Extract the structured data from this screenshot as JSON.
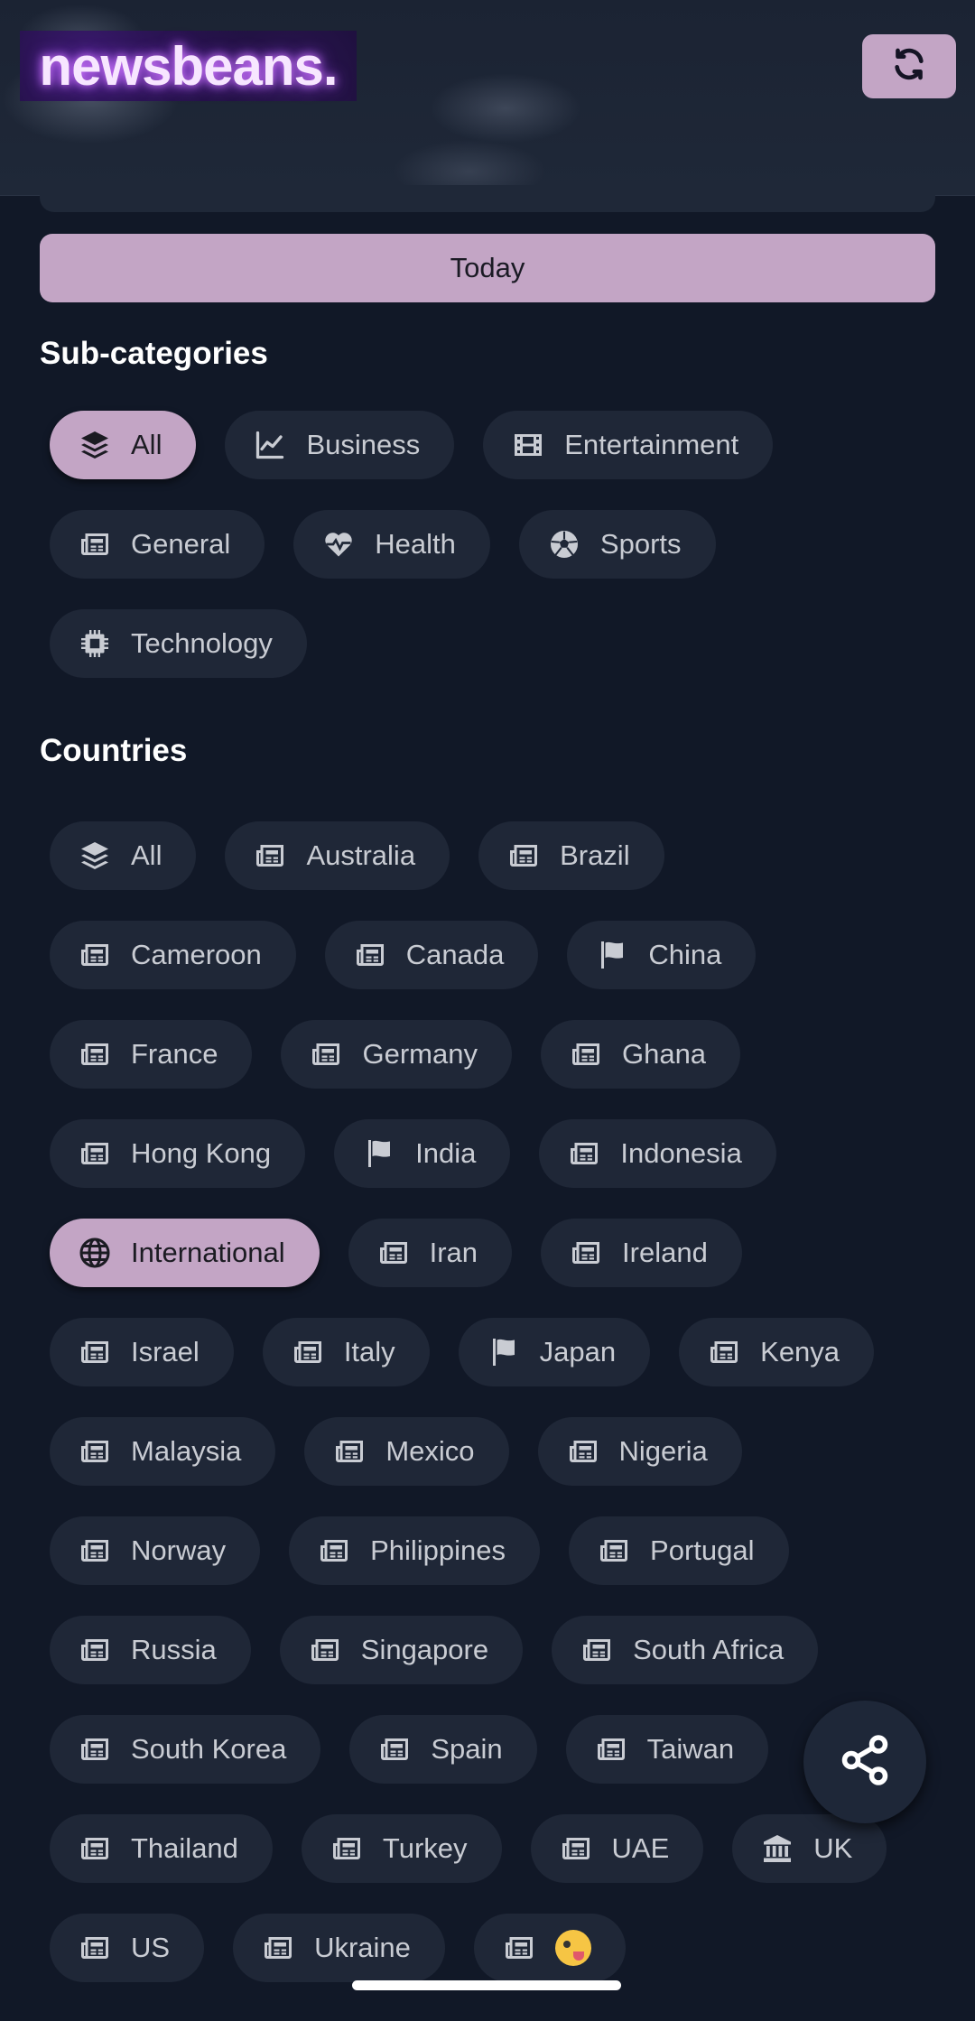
{
  "app": {
    "logo_text": "newsbeans."
  },
  "header": {
    "refresh_icon": "refresh-icon"
  },
  "today_button": {
    "label": "Today"
  },
  "subcategories": {
    "title": "Sub-categories",
    "items": [
      {
        "label": "All",
        "icon": "layers",
        "selected": true
      },
      {
        "label": "Business",
        "icon": "chart-line",
        "selected": false
      },
      {
        "label": "Entertainment",
        "icon": "film",
        "selected": false
      },
      {
        "label": "General",
        "icon": "newspaper",
        "selected": false
      },
      {
        "label": "Health",
        "icon": "heartbeat",
        "selected": false
      },
      {
        "label": "Sports",
        "icon": "soccer-ball",
        "selected": false
      },
      {
        "label": "Technology",
        "icon": "chip",
        "selected": false
      }
    ]
  },
  "countries": {
    "title": "Countries",
    "items": [
      {
        "label": "All",
        "icon": "layers",
        "selected": false
      },
      {
        "label": "Australia",
        "icon": "newspaper",
        "selected": false
      },
      {
        "label": "Brazil",
        "icon": "newspaper",
        "selected": false
      },
      {
        "label": "Cameroon",
        "icon": "newspaper",
        "selected": false
      },
      {
        "label": "Canada",
        "icon": "newspaper",
        "selected": false
      },
      {
        "label": "China",
        "icon": "flag",
        "selected": false
      },
      {
        "label": "France",
        "icon": "newspaper",
        "selected": false
      },
      {
        "label": "Germany",
        "icon": "newspaper",
        "selected": false
      },
      {
        "label": "Ghana",
        "icon": "newspaper",
        "selected": false
      },
      {
        "label": "Hong Kong",
        "icon": "newspaper",
        "selected": false
      },
      {
        "label": "India",
        "icon": "flag",
        "selected": false
      },
      {
        "label": "Indonesia",
        "icon": "newspaper",
        "selected": false
      },
      {
        "label": "International",
        "icon": "globe",
        "selected": true
      },
      {
        "label": "Iran",
        "icon": "newspaper",
        "selected": false
      },
      {
        "label": "Ireland",
        "icon": "newspaper",
        "selected": false
      },
      {
        "label": "Israel",
        "icon": "newspaper",
        "selected": false
      },
      {
        "label": "Italy",
        "icon": "newspaper",
        "selected": false
      },
      {
        "label": "Japan",
        "icon": "flag",
        "selected": false
      },
      {
        "label": "Kenya",
        "icon": "newspaper",
        "selected": false
      },
      {
        "label": "Malaysia",
        "icon": "newspaper",
        "selected": false
      },
      {
        "label": "Mexico",
        "icon": "newspaper",
        "selected": false
      },
      {
        "label": "Nigeria",
        "icon": "newspaper",
        "selected": false
      },
      {
        "label": "Norway",
        "icon": "newspaper",
        "selected": false
      },
      {
        "label": "Philippines",
        "icon": "newspaper",
        "selected": false
      },
      {
        "label": "Portugal",
        "icon": "newspaper",
        "selected": false
      },
      {
        "label": "Russia",
        "icon": "newspaper",
        "selected": false
      },
      {
        "label": "Singapore",
        "icon": "newspaper",
        "selected": false
      },
      {
        "label": "South Africa",
        "icon": "newspaper",
        "selected": false
      },
      {
        "label": "South Korea",
        "icon": "newspaper",
        "selected": false
      },
      {
        "label": "Spain",
        "icon": "newspaper",
        "selected": false
      },
      {
        "label": "Taiwan",
        "icon": "newspaper",
        "selected": false
      },
      {
        "label": "Thailand",
        "icon": "newspaper",
        "selected": false
      },
      {
        "label": "Turkey",
        "icon": "newspaper",
        "selected": false
      },
      {
        "label": "UAE",
        "icon": "newspaper",
        "selected": false
      },
      {
        "label": "UK",
        "icon": "landmark",
        "selected": false
      },
      {
        "label": "US",
        "icon": "newspaper",
        "selected": false
      },
      {
        "label": "Ukraine",
        "icon": "newspaper",
        "selected": false
      },
      {
        "label": "",
        "icon": "newspaper",
        "emoji": "zany-face",
        "selected": false
      }
    ]
  },
  "fab": {
    "icon": "share-icon"
  },
  "colors": {
    "background": "#111827",
    "chip": "#1f2737",
    "accent": "#c3a5c5",
    "chip_text": "#c9ccd3"
  }
}
